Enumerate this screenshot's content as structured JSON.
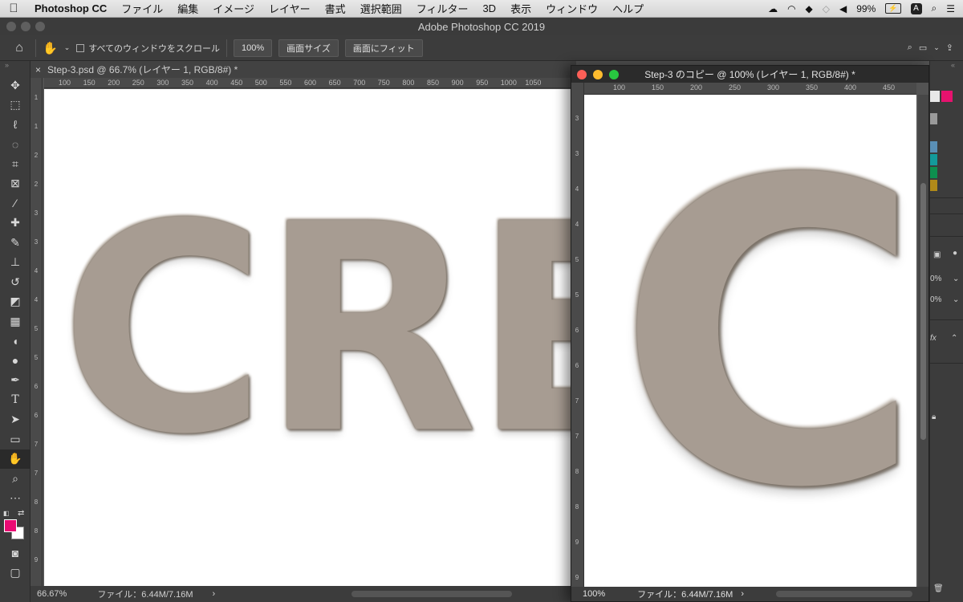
{
  "menubar": {
    "app": "Photoshop CC",
    "items": [
      "ファイル",
      "編集",
      "イメージ",
      "レイヤー",
      "書式",
      "選択範囲",
      "フィルター",
      "3D",
      "表示",
      "ウィンドウ",
      "ヘルプ"
    ],
    "battery": "99%",
    "input_indicator": "A"
  },
  "app_title": "Adobe Photoshop CC 2019",
  "options": {
    "scroll_all_label": "すべてのウィンドウをスクロール",
    "zoom_value": "100%",
    "actual_pixels_label": "画面サイズ",
    "fit_screen_label": "画面にフィット"
  },
  "left_doc": {
    "tab_title": "Step-3.psd @ 66.7% (レイヤー 1, RGB/8#) *",
    "ruler_ticks": [
      "100",
      "150",
      "200",
      "250",
      "300",
      "350",
      "400",
      "450",
      "500",
      "550",
      "600",
      "650",
      "700",
      "750",
      "800",
      "850",
      "900",
      "950",
      "1000",
      "1050"
    ],
    "vruler_ticks": [
      "1",
      "1",
      "2",
      "2",
      "3",
      "3",
      "4",
      "4",
      "5",
      "5",
      "6",
      "6",
      "7",
      "7",
      "8",
      "8",
      "9"
    ],
    "canvas_text": "CREAT",
    "zoom": "66.67%",
    "file_info": "ファイル：6.44M/7.16M"
  },
  "right_doc": {
    "title": "Step-3 のコピー @ 100% (レイヤー 1, RGB/8#) *",
    "ruler_ticks": [
      "100",
      "150",
      "200",
      "250",
      "300",
      "350",
      "400",
      "450"
    ],
    "vruler_ticks": [
      "3",
      "3",
      "4",
      "4",
      "5",
      "5",
      "6",
      "6",
      "7",
      "7",
      "8",
      "8",
      "9",
      "9"
    ],
    "canvas_text": "CR",
    "zoom": "100%",
    "file_info": "ファイル：6.44M/7.16M"
  },
  "panels": {
    "fx_label": "fx",
    "percent_1": "0%",
    "percent_2": "0%"
  },
  "colors": {
    "foreground": "#ea0a73",
    "background": "#ffffff",
    "swatches": [
      "#e8e8e8",
      "#e6126e",
      "#9a9a9a",
      "#5a8fb5",
      "#139a9b",
      "#0e8f4f",
      "#b08a19"
    ]
  },
  "tools": [
    "move-icon",
    "marquee-icon",
    "lasso-icon",
    "quick-select-icon",
    "crop-icon",
    "frame-icon",
    "eyedropper-icon",
    "healing-icon",
    "brush-icon",
    "stamp-icon",
    "history-brush-icon",
    "eraser-icon",
    "gradient-icon",
    "blur-icon",
    "dodge-icon",
    "pen-icon",
    "type-icon",
    "path-select-icon",
    "rectangle-icon",
    "hand-icon",
    "zoom-icon",
    "more-icon"
  ]
}
